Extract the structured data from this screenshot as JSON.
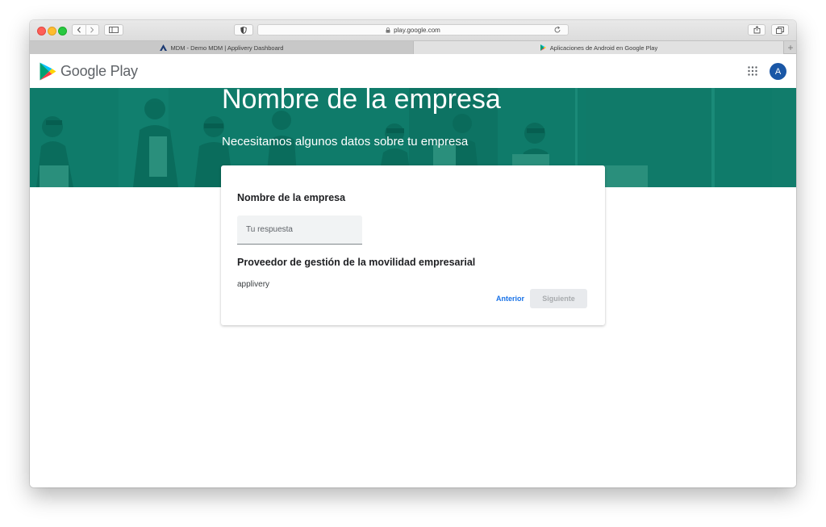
{
  "browser": {
    "url": "play.google.com",
    "tabs": [
      {
        "label": "MDM - Demo MDM | Applivery Dashboard"
      },
      {
        "label": "Aplicaciones de Android en Google Play"
      }
    ],
    "new_tab_label": "+"
  },
  "header": {
    "logo_text": "Google Play",
    "avatar_initial": "A"
  },
  "banner": {
    "title": "Nombre de la empresa",
    "subtitle": "Necesitamos algunos datos sobre tu empresa"
  },
  "form": {
    "question1_label": "Nombre de la empresa",
    "answer_placeholder": "Tu respuesta",
    "question2_label": "Proveedor de gestión de la movilidad empresarial",
    "question2_value": "applivery",
    "prev_label": "Anterior",
    "next_label": "Siguiente"
  },
  "colors": {
    "banner_bg": "#0f7b6a",
    "accent_blue": "#1a73e8",
    "avatar_bg": "#1a57a6"
  }
}
